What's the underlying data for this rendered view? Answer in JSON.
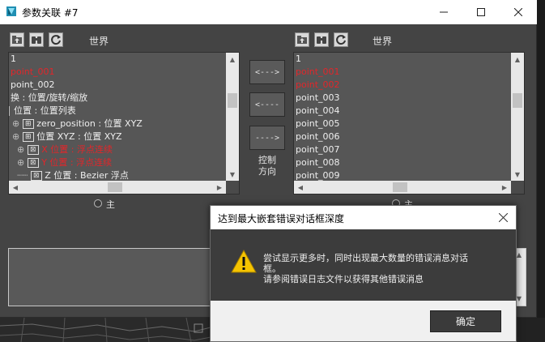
{
  "window": {
    "title": "参数关联 #7",
    "minimize_icon": "minimize-icon",
    "maximize_icon": "maximize-icon",
    "close_icon": "close-icon"
  },
  "left_panel": {
    "toolbar_label": "世界",
    "tree_items": [
      {
        "text": "1",
        "color": "#eeeeee"
      },
      {
        "text": "point_001",
        "color": "#e2262a"
      },
      {
        "text": "point_002",
        "color": "#eeeeee"
      },
      {
        "text": "换 : 位置/旋转/缩放",
        "color": "#eeeeee"
      },
      {
        "text": "位置 : 位置列表",
        "color": "#eeeeee"
      },
      {
        "text": "zero_position : 位置 XYZ",
        "color": "#eeeeee"
      },
      {
        "text": "位置 XYZ : 位置 XYZ",
        "color": "#eeeeee"
      },
      {
        "text": "X 位置 : 浮点连续",
        "color": "#e2262a"
      },
      {
        "text": "Y 位置 : 浮点连续",
        "color": "#e2262a"
      },
      {
        "text": "Z 位置 : Bezier 浮点",
        "color": "#eeeeee"
      }
    ],
    "radio_label": "主"
  },
  "right_panel": {
    "toolbar_label": "世界",
    "tree_items": [
      {
        "text": "1",
        "color": "#eeeeee"
      },
      {
        "text": "point_001",
        "color": "#e2262a"
      },
      {
        "text": "point_002",
        "color": "#e2262a"
      },
      {
        "text": "point_003",
        "color": "#eeeeee"
      },
      {
        "text": "point_004",
        "color": "#eeeeee"
      },
      {
        "text": "point_005",
        "color": "#eeeeee"
      },
      {
        "text": "point_006",
        "color": "#eeeeee"
      },
      {
        "text": "point_007",
        "color": "#eeeeee"
      },
      {
        "text": "point_008",
        "color": "#eeeeee"
      },
      {
        "text": "point_009",
        "color": "#eeeeee"
      }
    ],
    "radio_label": "主"
  },
  "direction_controls": {
    "both_label": "<--->",
    "left_label": "<----",
    "right_label": "---->",
    "caption_line1": "控制",
    "caption_line2": "方向"
  },
  "dialog": {
    "title": "达到最大嵌套错误对话框深度",
    "message_line1": "尝试显示更多时，同时出现最大数量的错误消息对话",
    "message_line2": "框。",
    "message_line3": "请参阅错误日志文件以获得其他错误消息",
    "ok_label": "确定",
    "icon": "warning-icon"
  },
  "colors": {
    "panel_bg": "#444444",
    "tree_bg": "#565656",
    "error_red": "#e2262a",
    "warning_yellow": "#f5c400"
  }
}
